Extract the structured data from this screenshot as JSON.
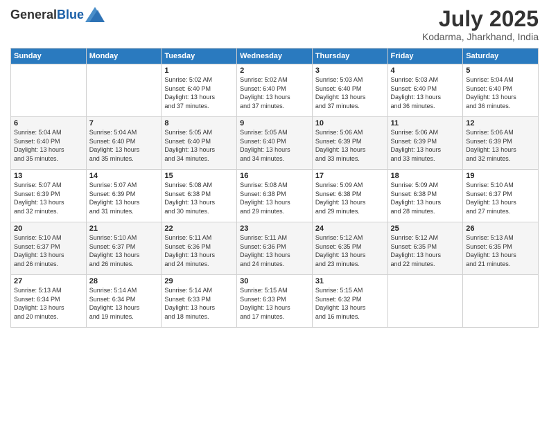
{
  "logo": {
    "general": "General",
    "blue": "Blue"
  },
  "header": {
    "month": "July 2025",
    "location": "Kodarma, Jharkhand, India"
  },
  "weekdays": [
    "Sunday",
    "Monday",
    "Tuesday",
    "Wednesday",
    "Thursday",
    "Friday",
    "Saturday"
  ],
  "weeks": [
    [
      {
        "day": "",
        "info": ""
      },
      {
        "day": "",
        "info": ""
      },
      {
        "day": "1",
        "info": "Sunrise: 5:02 AM\nSunset: 6:40 PM\nDaylight: 13 hours\nand 37 minutes."
      },
      {
        "day": "2",
        "info": "Sunrise: 5:02 AM\nSunset: 6:40 PM\nDaylight: 13 hours\nand 37 minutes."
      },
      {
        "day": "3",
        "info": "Sunrise: 5:03 AM\nSunset: 6:40 PM\nDaylight: 13 hours\nand 37 minutes."
      },
      {
        "day": "4",
        "info": "Sunrise: 5:03 AM\nSunset: 6:40 PM\nDaylight: 13 hours\nand 36 minutes."
      },
      {
        "day": "5",
        "info": "Sunrise: 5:04 AM\nSunset: 6:40 PM\nDaylight: 13 hours\nand 36 minutes."
      }
    ],
    [
      {
        "day": "6",
        "info": "Sunrise: 5:04 AM\nSunset: 6:40 PM\nDaylight: 13 hours\nand 35 minutes."
      },
      {
        "day": "7",
        "info": "Sunrise: 5:04 AM\nSunset: 6:40 PM\nDaylight: 13 hours\nand 35 minutes."
      },
      {
        "day": "8",
        "info": "Sunrise: 5:05 AM\nSunset: 6:40 PM\nDaylight: 13 hours\nand 34 minutes."
      },
      {
        "day": "9",
        "info": "Sunrise: 5:05 AM\nSunset: 6:40 PM\nDaylight: 13 hours\nand 34 minutes."
      },
      {
        "day": "10",
        "info": "Sunrise: 5:06 AM\nSunset: 6:39 PM\nDaylight: 13 hours\nand 33 minutes."
      },
      {
        "day": "11",
        "info": "Sunrise: 5:06 AM\nSunset: 6:39 PM\nDaylight: 13 hours\nand 33 minutes."
      },
      {
        "day": "12",
        "info": "Sunrise: 5:06 AM\nSunset: 6:39 PM\nDaylight: 13 hours\nand 32 minutes."
      }
    ],
    [
      {
        "day": "13",
        "info": "Sunrise: 5:07 AM\nSunset: 6:39 PM\nDaylight: 13 hours\nand 32 minutes."
      },
      {
        "day": "14",
        "info": "Sunrise: 5:07 AM\nSunset: 6:39 PM\nDaylight: 13 hours\nand 31 minutes."
      },
      {
        "day": "15",
        "info": "Sunrise: 5:08 AM\nSunset: 6:38 PM\nDaylight: 13 hours\nand 30 minutes."
      },
      {
        "day": "16",
        "info": "Sunrise: 5:08 AM\nSunset: 6:38 PM\nDaylight: 13 hours\nand 29 minutes."
      },
      {
        "day": "17",
        "info": "Sunrise: 5:09 AM\nSunset: 6:38 PM\nDaylight: 13 hours\nand 29 minutes."
      },
      {
        "day": "18",
        "info": "Sunrise: 5:09 AM\nSunset: 6:38 PM\nDaylight: 13 hours\nand 28 minutes."
      },
      {
        "day": "19",
        "info": "Sunrise: 5:10 AM\nSunset: 6:37 PM\nDaylight: 13 hours\nand 27 minutes."
      }
    ],
    [
      {
        "day": "20",
        "info": "Sunrise: 5:10 AM\nSunset: 6:37 PM\nDaylight: 13 hours\nand 26 minutes."
      },
      {
        "day": "21",
        "info": "Sunrise: 5:10 AM\nSunset: 6:37 PM\nDaylight: 13 hours\nand 26 minutes."
      },
      {
        "day": "22",
        "info": "Sunrise: 5:11 AM\nSunset: 6:36 PM\nDaylight: 13 hours\nand 24 minutes."
      },
      {
        "day": "23",
        "info": "Sunrise: 5:11 AM\nSunset: 6:36 PM\nDaylight: 13 hours\nand 24 minutes."
      },
      {
        "day": "24",
        "info": "Sunrise: 5:12 AM\nSunset: 6:35 PM\nDaylight: 13 hours\nand 23 minutes."
      },
      {
        "day": "25",
        "info": "Sunrise: 5:12 AM\nSunset: 6:35 PM\nDaylight: 13 hours\nand 22 minutes."
      },
      {
        "day": "26",
        "info": "Sunrise: 5:13 AM\nSunset: 6:35 PM\nDaylight: 13 hours\nand 21 minutes."
      }
    ],
    [
      {
        "day": "27",
        "info": "Sunrise: 5:13 AM\nSunset: 6:34 PM\nDaylight: 13 hours\nand 20 minutes."
      },
      {
        "day": "28",
        "info": "Sunrise: 5:14 AM\nSunset: 6:34 PM\nDaylight: 13 hours\nand 19 minutes."
      },
      {
        "day": "29",
        "info": "Sunrise: 5:14 AM\nSunset: 6:33 PM\nDaylight: 13 hours\nand 18 minutes."
      },
      {
        "day": "30",
        "info": "Sunrise: 5:15 AM\nSunset: 6:33 PM\nDaylight: 13 hours\nand 17 minutes."
      },
      {
        "day": "31",
        "info": "Sunrise: 5:15 AM\nSunset: 6:32 PM\nDaylight: 13 hours\nand 16 minutes."
      },
      {
        "day": "",
        "info": ""
      },
      {
        "day": "",
        "info": ""
      }
    ]
  ]
}
